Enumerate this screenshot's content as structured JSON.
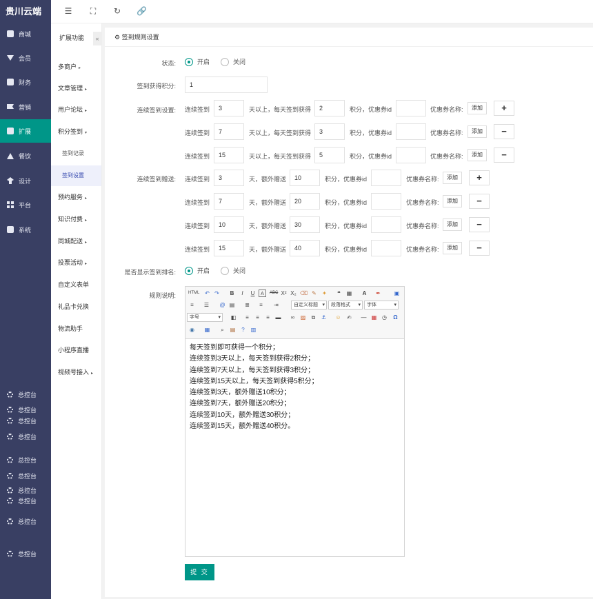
{
  "brand": "贵川云端",
  "sidebar": {
    "items": [
      {
        "label": "商城",
        "icon": "shop-icon"
      },
      {
        "label": "会员",
        "icon": "diamond-icon"
      },
      {
        "label": "财务",
        "icon": "wallet-icon"
      },
      {
        "label": "营销",
        "icon": "megaphone-icon"
      },
      {
        "label": "扩展",
        "icon": "cube-icon"
      },
      {
        "label": "餐饮",
        "icon": "dining-icon"
      },
      {
        "label": "设计",
        "icon": "pin-icon"
      },
      {
        "label": "平台",
        "icon": "grid-icon"
      },
      {
        "label": "系统",
        "icon": "monitor-icon"
      }
    ],
    "bottom_items": [
      "总控台",
      "总控台",
      "总控台",
      "总控台",
      "总控台",
      "总控台",
      "总控台",
      "总控台",
      "总控台",
      "总控台"
    ]
  },
  "subnav": {
    "title": "扩展功能",
    "collapse": "«",
    "items": [
      {
        "label": "多商户",
        "caret": "▸"
      },
      {
        "label": "文章管理",
        "caret": "▸"
      },
      {
        "label": "用户论坛",
        "caret": "▸"
      },
      {
        "label": "积分签到",
        "caret": "▾"
      },
      {
        "label": "签到记录",
        "caret": ""
      },
      {
        "label": "签到设置",
        "caret": ""
      },
      {
        "label": "预约服务",
        "caret": "▸"
      },
      {
        "label": "知识付费",
        "caret": "▸"
      },
      {
        "label": "同城配送",
        "caret": "▸"
      },
      {
        "label": "投票活动",
        "caret": "▸"
      },
      {
        "label": "自定义表单",
        "caret": ""
      },
      {
        "label": "礼品卡兑换",
        "caret": ""
      },
      {
        "label": "物流助手",
        "caret": ""
      },
      {
        "label": "小程序直播",
        "caret": ""
      },
      {
        "label": "视频号接入",
        "caret": "▸"
      }
    ]
  },
  "topbar": {
    "icons": [
      "menu-fold-icon",
      "fullscreen-icon",
      "refresh-icon",
      "link-icon"
    ]
  },
  "panel": {
    "title": "签到规则设置"
  },
  "form": {
    "status_label": "状态:",
    "on_label": "开启",
    "off_label": "关闭",
    "points_label": "签到获得积分:",
    "points_value": "1",
    "continuous_label": "连续签到设置:",
    "continuous_rows": [
      {
        "days": "3",
        "points": "2",
        "coupon_id": "",
        "action": "+"
      },
      {
        "days": "7",
        "points": "3",
        "coupon_id": "",
        "action": "−"
      },
      {
        "days": "15",
        "points": "5",
        "coupon_id": "",
        "action": "−"
      }
    ],
    "continuous_text": {
      "prefix": "连续签到",
      "middle": "天以上，每天签到获得",
      "suffix": "积分，优惠券id",
      "coupon_name": "优惠券名称:",
      "add": "添加"
    },
    "gift_label": "连续签到赠送:",
    "gift_rows": [
      {
        "days": "3",
        "points": "10",
        "coupon_id": "",
        "action": "+"
      },
      {
        "days": "7",
        "points": "20",
        "coupon_id": "",
        "action": "−"
      },
      {
        "days": "10",
        "points": "30",
        "coupon_id": "",
        "action": "−"
      },
      {
        "days": "15",
        "points": "40",
        "coupon_id": "",
        "action": "−"
      }
    ],
    "gift_text": {
      "prefix": "连续签到",
      "middle": "天，额外赠送",
      "suffix": "积分，优惠券id",
      "coupon_name": "优惠券名称:",
      "add": "添加"
    },
    "ranking_label": "是否显示签到排名:",
    "rules_label": "规则说明:",
    "submit": "提 交"
  },
  "editor": {
    "selects": {
      "title": "自定义标题",
      "paragraph": "段落格式",
      "font": "字体",
      "size": "字号"
    },
    "content": [
      "每天签到即可获得一个积分；",
      "连续签到3天以上，每天签到获得2积分；",
      "连续签到7天以上，每天签到获得3积分；",
      "连续签到15天以上，每天签到获得5积分；",
      "连续签到3天，额外赠送10积分；",
      "连续签到7天，额外赠送20积分；",
      "连续签到10天，额外赠送30积分；",
      "连续签到15天，额外赠送40积分。"
    ]
  },
  "colors": {
    "sidebar": "#393f63",
    "accent": "#009688",
    "subnav_active": "#eef0fb"
  }
}
